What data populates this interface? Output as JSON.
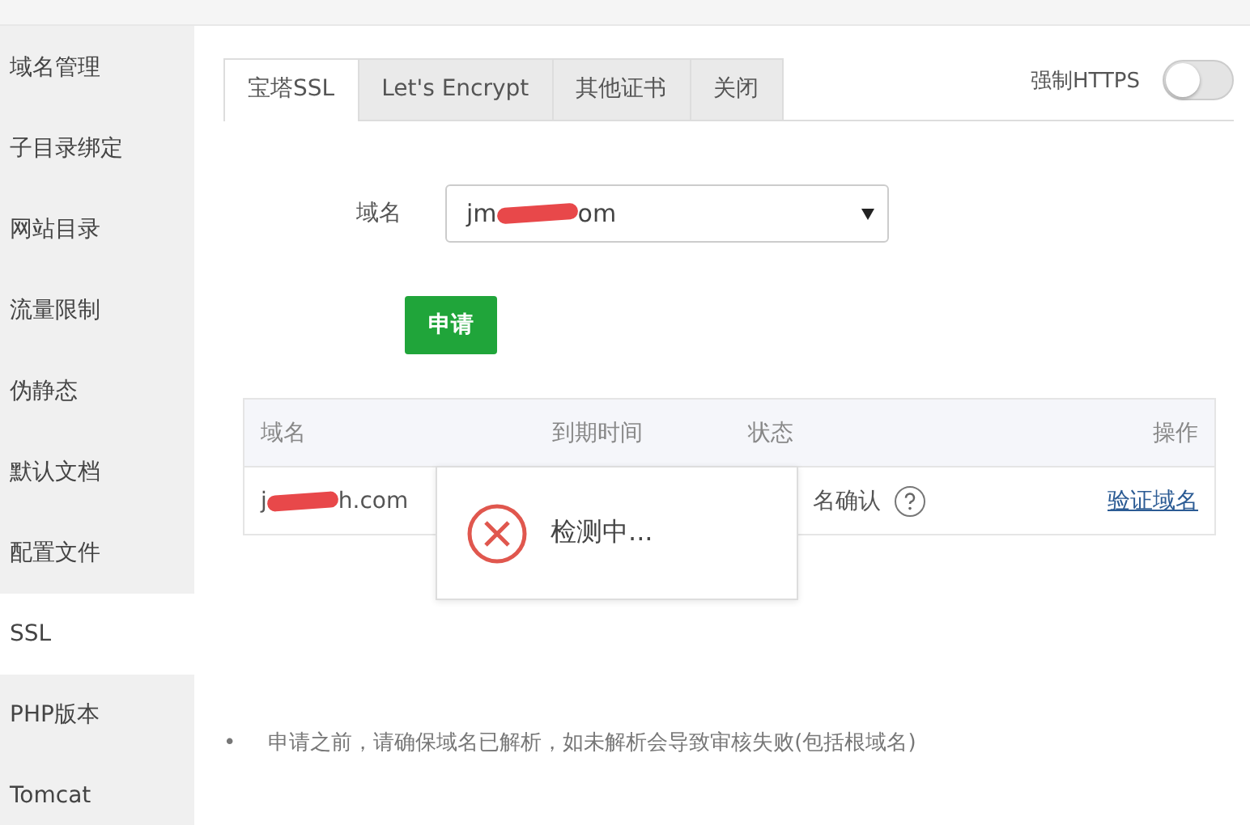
{
  "sidebar": {
    "items": [
      {
        "label": "域名管理",
        "selected": false
      },
      {
        "label": "子目录绑定",
        "selected": false
      },
      {
        "label": "网站目录",
        "selected": false
      },
      {
        "label": "流量限制",
        "selected": false
      },
      {
        "label": "伪静态",
        "selected": false
      },
      {
        "label": "默认文档",
        "selected": false
      },
      {
        "label": "配置文件",
        "selected": false
      },
      {
        "label": "SSL",
        "selected": true
      },
      {
        "label": "PHP版本",
        "selected": false
      },
      {
        "label": "Tomcat",
        "selected": false
      }
    ]
  },
  "tabs": [
    {
      "label": "宝塔SSL",
      "selected": true
    },
    {
      "label": "Let's Encrypt",
      "selected": false
    },
    {
      "label": "其他证书",
      "selected": false
    },
    {
      "label": "关闭",
      "selected": false
    }
  ],
  "force_https": {
    "label": "强制HTTPS",
    "on": false
  },
  "domain_field": {
    "label": "域名",
    "value_start": "jm",
    "value_end": "om",
    "redacted": true
  },
  "apply_button": "申请",
  "table": {
    "columns": [
      "域名",
      "到期时间",
      "状态",
      "操作"
    ],
    "rows": [
      {
        "domain_start": "j",
        "domain_end": "h.com",
        "redacted": true,
        "status": "名确认",
        "action": "验证域名"
      }
    ]
  },
  "toast": {
    "message": "检测中..."
  },
  "notes": [
    {
      "bullet": "•",
      "text": "申请之前，请确保域名已解析，如未解析会导致审核失败(包括根域名)"
    }
  ]
}
